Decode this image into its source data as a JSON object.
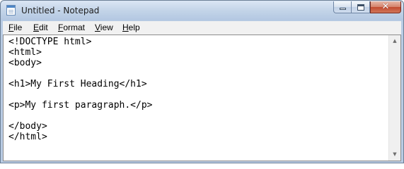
{
  "window": {
    "title": "Untitled - Notepad",
    "icon": "notepad-icon",
    "controls": {
      "minimize_icon": "minimize-icon",
      "maximize_icon": "maximize-icon",
      "close_glyph": "✕"
    }
  },
  "menu": {
    "items": [
      {
        "mnemonic": "F",
        "rest": "ile"
      },
      {
        "mnemonic": "E",
        "rest": "dit"
      },
      {
        "mnemonic": "F",
        "rest": "ormat"
      },
      {
        "mnemonic": "V",
        "rest": "iew"
      },
      {
        "mnemonic": "H",
        "rest": "elp"
      }
    ]
  },
  "editor": {
    "content": "<!DOCTYPE html>\n<html>\n<body>\n\n<h1>My First Heading</h1>\n\n<p>My first paragraph.</p>\n\n</body>\n</html>"
  },
  "scrollbar": {
    "up_glyph": "▲",
    "down_glyph": "▼"
  }
}
